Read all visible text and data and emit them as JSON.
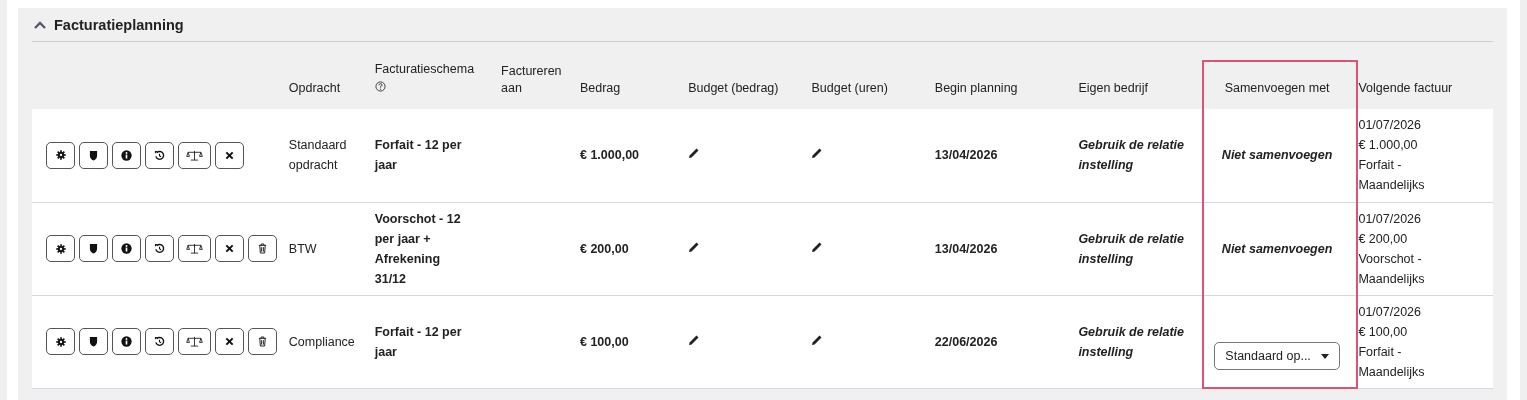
{
  "section": {
    "title": "Facturatieplanning",
    "expanded": true
  },
  "columns": [
    {},
    {
      "label": "Opdracht"
    },
    {
      "label": "Facturatieschema",
      "help": true
    },
    {
      "label": "Factureren aan"
    },
    {
      "label": "Bedrag"
    },
    {
      "label": "Budget (bedrag)"
    },
    {
      "label": "Budget (uren)"
    },
    {
      "label": "Begin planning"
    },
    {
      "label": "Eigen bedrijf"
    },
    {
      "label": "Samenvoegen met",
      "highlighted": true
    },
    {
      "label": "Volgende factuur"
    }
  ],
  "rows": [
    {
      "actions": [
        {
          "kind": "settings"
        },
        {
          "kind": "shield"
        },
        {
          "kind": "info"
        },
        {
          "kind": "history"
        },
        {
          "kind": "scale"
        },
        {
          "kind": "close"
        }
      ],
      "opdracht": "Standaard opdracht",
      "schema": "Forfait - 12 per jaar",
      "bedrag": "€ 1.000,00",
      "begin": "13/04/2026",
      "eigen_bedrijf": "Gebruik de relatie instelling",
      "merge": {
        "kind": "text",
        "value": "Niet samenvoegen"
      },
      "next": [
        "01/07/2026",
        "€ 1.000,00",
        "Forfait - Maandelijks"
      ]
    },
    {
      "actions": [
        {
          "kind": "settings"
        },
        {
          "kind": "shield"
        },
        {
          "kind": "info"
        },
        {
          "kind": "history"
        },
        {
          "kind": "scale"
        },
        {
          "kind": "close"
        },
        {
          "kind": "delete"
        }
      ],
      "opdracht": "BTW",
      "schema": "Voorschot - 12 per jaar + Afrekening 31/12",
      "bedrag": "€ 200,00",
      "begin": "13/04/2026",
      "eigen_bedrijf": "Gebruik de relatie instelling",
      "merge": {
        "kind": "text",
        "value": "Niet samenvoegen"
      },
      "next": [
        "01/07/2026",
        "€ 200,00",
        "Voorschot - Maandelijks"
      ]
    },
    {
      "actions": [
        {
          "kind": "settings"
        },
        {
          "kind": "shield"
        },
        {
          "kind": "info"
        },
        {
          "kind": "history"
        },
        {
          "kind": "scale"
        },
        {
          "kind": "close"
        },
        {
          "kind": "delete"
        }
      ],
      "opdracht": "Compliance",
      "schema": "Forfait - 12 per jaar",
      "bedrag": "€ 100,00",
      "begin": "22/06/2026",
      "eigen_bedrijf": "Gebruik de relatie instelling",
      "merge": {
        "kind": "dropdown",
        "value": "Standaard op..."
      },
      "next": [
        "01/07/2026",
        "€ 100,00",
        "Forfait - Maandelijks"
      ]
    }
  ]
}
